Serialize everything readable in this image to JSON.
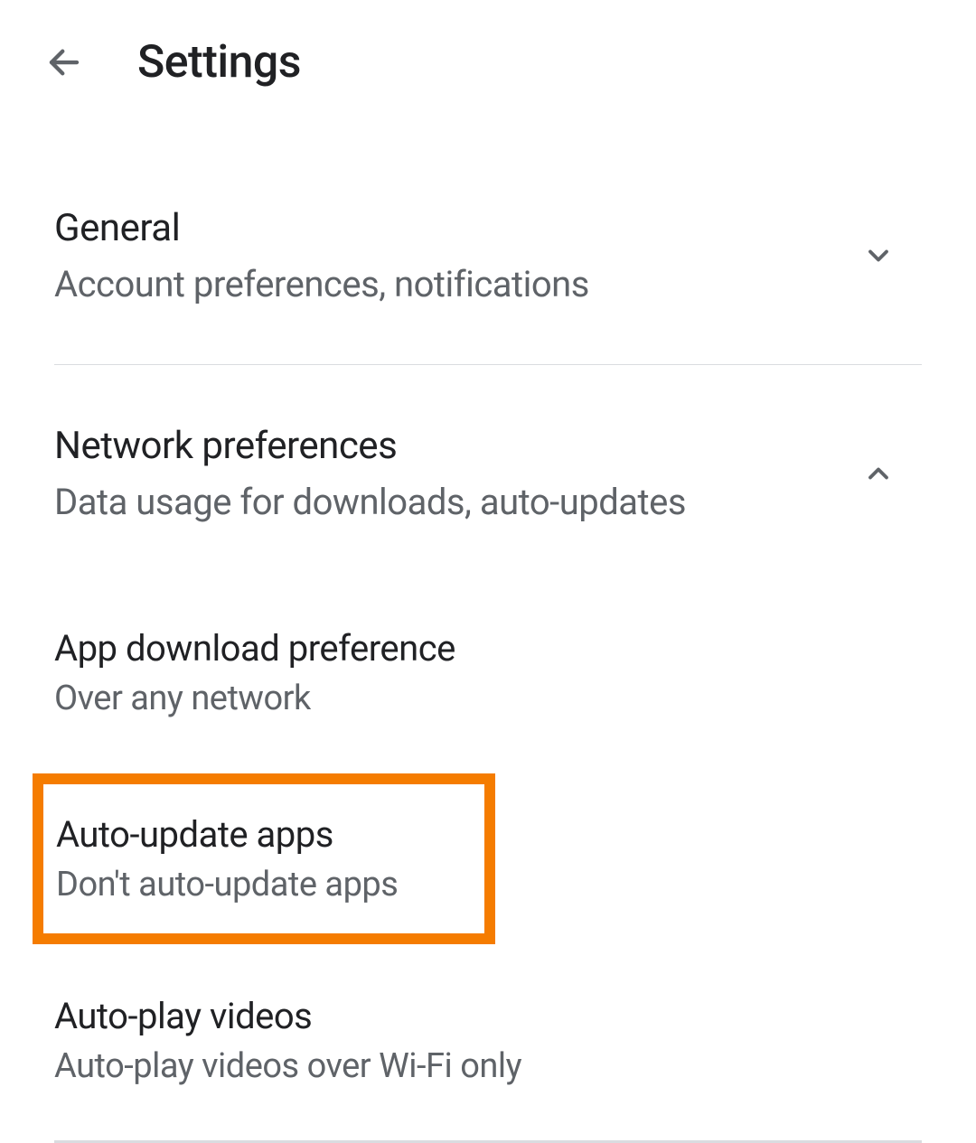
{
  "header": {
    "title": "Settings"
  },
  "sections": {
    "general": {
      "title": "General",
      "subtitle": "Account preferences, notifications"
    },
    "network": {
      "title": "Network preferences",
      "subtitle": "Data usage for downloads, auto-updates"
    }
  },
  "items": {
    "app_download": {
      "title": "App download preference",
      "subtitle": "Over any network"
    },
    "auto_update": {
      "title": "Auto-update apps",
      "subtitle": "Don't auto-update apps"
    },
    "auto_play": {
      "title": "Auto-play videos",
      "subtitle": "Auto-play videos over Wi-Fi only"
    }
  }
}
